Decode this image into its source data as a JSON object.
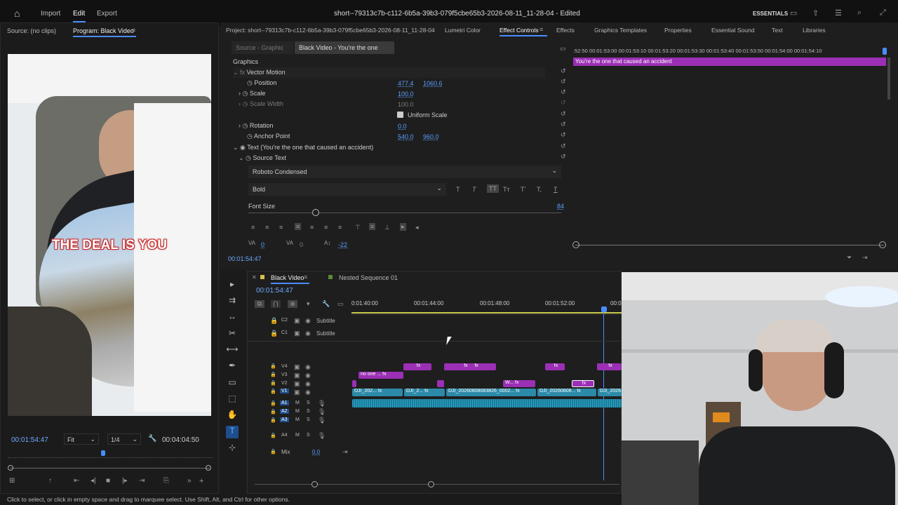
{
  "app": {
    "title": "short--79313c7b-c112-6b5a-39b3-079f5cbe65b3-2026-08-11_11-28-04 - Edited",
    "menu": [
      "Import",
      "Edit",
      "Export"
    ],
    "workspace": "ESSENTIALS"
  },
  "source_monitor": {
    "source_label": "Source: (no clips)",
    "program_label": "Program: Black Video"
  },
  "video": {
    "caption": "THE DEAL IS YOU"
  },
  "program_controls": {
    "timecode": "00:01:54:47",
    "fit": "Fit",
    "resolution": "1/4",
    "duration": "00:04:04:50"
  },
  "project_tabs": {
    "project": "Project: short--79313c7b-c112-6b5a-39b3-079f5cbe65b3-2026-08-11_11-28-04",
    "tabs": [
      "Lumetri Color",
      "Effect Controls",
      "Effects",
      "Graphics Templates",
      "Properties",
      "Essential Sound",
      "Text",
      "Libraries"
    ]
  },
  "effect_controls": {
    "source_tab": "Source - Graphic",
    "clip_tab": "Black Video - You're the one",
    "section": "Graphics",
    "vector_motion": "Vector Motion",
    "position": {
      "label": "Position",
      "x": "477.4",
      "y": "1060.6"
    },
    "scale": {
      "label": "Scale",
      "value": "100.0"
    },
    "scale_width": {
      "label": "Scale Width",
      "value": "100.0"
    },
    "uniform_scale": "Uniform Scale",
    "rotation": {
      "label": "Rotation",
      "value": "0.0"
    },
    "anchor": {
      "label": "Anchor Point",
      "x": "540.0",
      "y": "960.0"
    },
    "text_layer": "Text (You're the one that caused an accident)",
    "source_text": "Source Text",
    "font": "Roboto Condensed",
    "style": "Bold",
    "font_size_label": "Font Size",
    "font_size": "84",
    "tracking": "0",
    "kerning": "0",
    "leading": "-22",
    "timecode": "00:01:54:47"
  },
  "mini_timeline": {
    "ticks": ":52:50   00:01:53:00   00:01:53:10   00:01:53:20   00:01:53:30   00:01:53:40   00:01:53:50   00:01:54:00   00:01:54:10",
    "clip": "You're the one that caused an accident"
  },
  "timeline": {
    "tabs": [
      "Black Video",
      "Nested Sequence 01"
    ],
    "timecode": "00:01:54:47",
    "ruler": [
      "0:01:40:00",
      "00:01:44:00",
      "00:01:48:00",
      "00:01:52:00",
      "00:0"
    ],
    "caption_tracks": [
      {
        "id": "C2",
        "name": "Subtitle"
      },
      {
        "id": "C1",
        "name": "Subtitle"
      }
    ],
    "video_tracks": [
      "V4",
      "V3",
      "V2",
      "V1"
    ],
    "audio_tracks": [
      "A1",
      "A2",
      "A3",
      "A4"
    ],
    "mix_label": "Mix",
    "mix_value": "0.0",
    "clips": {
      "v3": "no one ...",
      "v2": "W...",
      "v1a": "DJI_202...",
      "v1b": "DJI_2...",
      "v1c": "DJI_20260808083826_0002...",
      "v1d": "DJI_20260808...",
      "v1e": "DJI_2026"
    }
  },
  "status": "Click to select, or click in empty space and drag to marquee select. Use Shift, Alt, and Ctrl for other options."
}
